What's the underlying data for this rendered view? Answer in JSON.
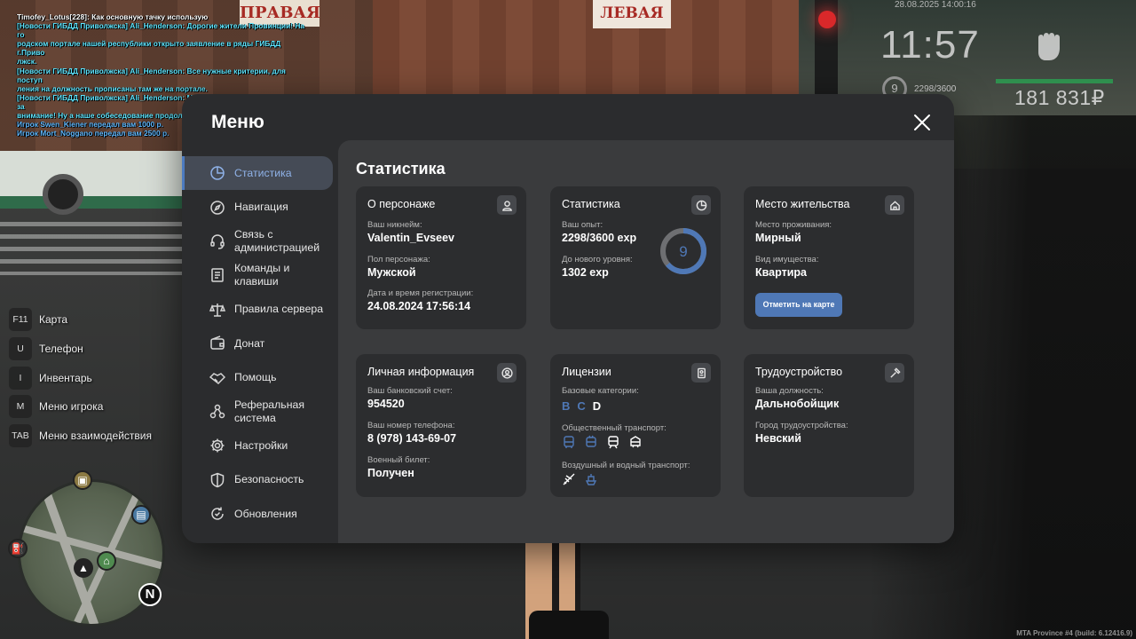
{
  "background": {
    "sign_right": "ПРАВАЯ",
    "sign_left": "ЛЕВАЯ",
    "build": "MTA Province #4 (build: 6.12416.9)"
  },
  "chat": [
    {
      "text": "Timofey_Lotus[228]: Как основную тачку использую",
      "color": "white"
    },
    {
      "text": "[Новости ГИБДД Приволжска] Ali_Henderson: Дорогие жители Провинции! На го",
      "color": "cyan"
    },
    {
      "text": "родском портале нашей республики открыто заявление в ряды ГИБДД г.Приво",
      "color": "cyan"
    },
    {
      "text": "лжск.",
      "color": "cyan"
    },
    {
      "text": "[Новости ГИБДД Приволжска] Ali_Henderson: Все нужные критерии, для поступ",
      "color": "cyan"
    },
    {
      "text": "ления на должность прописаны там же на портале.",
      "color": "cyan"
    },
    {
      "text": "[Новости ГИБДД Приволжска] Ali_Henderson: Мы ждём именно Вас! Спасибо за",
      "color": "cyan"
    },
    {
      "text": " внимание! Ну а наше собеседование продолжается!",
      "color": "cyan"
    },
    {
      "text": "Игрок Swen_Kiener передал вам 1000 р.",
      "color": "blue"
    },
    {
      "text": "Игрок Mort_Noggano передал вам 2500 р.",
      "color": "blue"
    }
  ],
  "hud": {
    "date": "28.08.2025 14:00:16",
    "time": "11:57",
    "level": "9",
    "exp": "2298/3600",
    "money": "181 831₽"
  },
  "quick_keys": [
    {
      "key": "F11",
      "label": "Карта"
    },
    {
      "key": "U",
      "label": "Телефон"
    },
    {
      "key": "I",
      "label": "Инвентарь"
    },
    {
      "key": "M",
      "label": "Меню игрока"
    },
    {
      "key": "TAB",
      "label": "Меню взаимодействия"
    }
  ],
  "minimap": {
    "north": "N"
  },
  "menu": {
    "title": "Меню",
    "sidebar": [
      {
        "label": "Статистика",
        "icon": "chart-icon",
        "active": true
      },
      {
        "label": "Навигация",
        "icon": "compass-icon"
      },
      {
        "label": "Связь с администрацией",
        "icon": "headset-icon"
      },
      {
        "label": "Команды и клавиши",
        "icon": "document-icon"
      },
      {
        "label": "Правила сервера",
        "icon": "scales-icon"
      },
      {
        "label": "Донат",
        "icon": "wallet-icon"
      },
      {
        "label": "Помощь",
        "icon": "handshake-icon"
      },
      {
        "label": "Реферальная система",
        "icon": "network-icon"
      },
      {
        "label": "Настройки",
        "icon": "gear-icon"
      },
      {
        "label": "Безопасность",
        "icon": "shield-icon"
      },
      {
        "label": "Обновления",
        "icon": "refresh-icon"
      }
    ]
  },
  "stats": {
    "title": "Статистика",
    "character": {
      "title": "О персонаже",
      "nickname_label": "Ваш никнейм:",
      "nickname": "Valentin_Evseev",
      "gender_label": "Пол персонажа:",
      "gender": "Мужской",
      "reg_label": "Дата и время регистрации:",
      "reg_date": "24.08.2024 17:56:14"
    },
    "statistics": {
      "title": "Статистика",
      "exp_label": "Ваш опыт:",
      "exp": "2298/3600 exp",
      "next_label": "До нового уровня:",
      "next": "1302 exp",
      "level": "9",
      "progress": 0.638
    },
    "residence": {
      "title": "Место жительства",
      "place_label": "Место проживания:",
      "place": "Мирный",
      "property_label": "Вид имущества:",
      "property": "Квартира",
      "map_button": "Отметить на карте"
    },
    "personal": {
      "title": "Личная информация",
      "bank_label": "Ваш банковский счет:",
      "bank": "954520",
      "phone_label": "Ваш номер телефона:",
      "phone": "8 (978) 143-69-07",
      "military_label": "Военный билет:",
      "military": "Получен"
    },
    "licenses": {
      "title": "Лицензии",
      "basic_label": "Базовые категории:",
      "cat_b": "B",
      "cat_c": "C",
      "cat_d": "D",
      "public_label": "Общественный транспорт:",
      "air_label": "Воздушный и водный транспорт:"
    },
    "employment": {
      "title": "Трудоустройство",
      "position_label": "Ваша должность:",
      "position": "Дальнобойщик",
      "city_label": "Город трудоустройства:",
      "city": "Невский"
    }
  },
  "colors": {
    "accent": "#4f78b6",
    "panel": "#2b2c2e",
    "content": "#3a3b3d",
    "card": "#2c2d2f"
  }
}
